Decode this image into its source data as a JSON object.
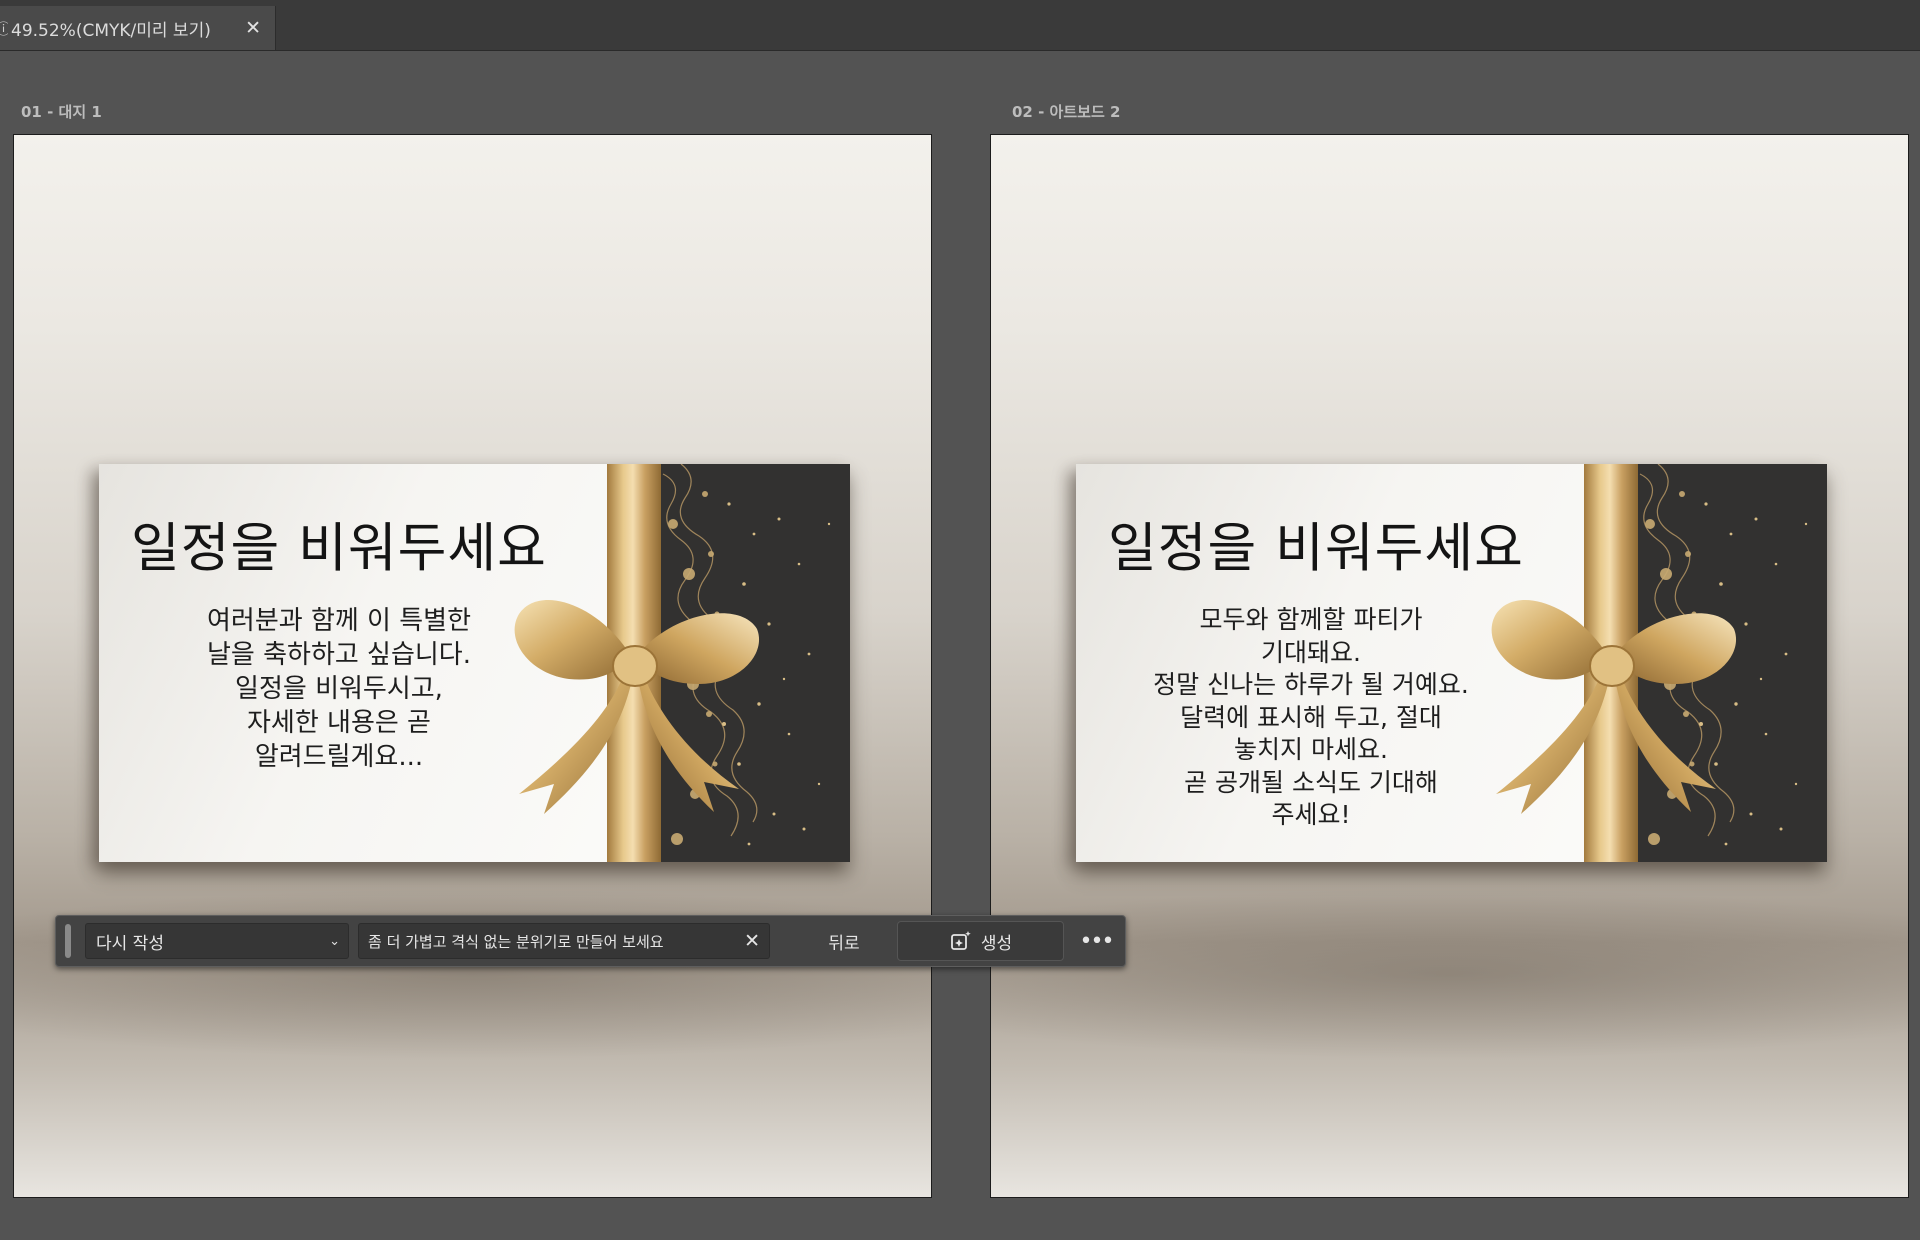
{
  "document_tab": {
    "edge_glyph": "ⓘ",
    "title": "49.52%(CMYK/미리 보기)",
    "close_glyph": "✕"
  },
  "artboards": [
    {
      "label": "01 - 대지 1",
      "card": {
        "title": "일정을 비워두세요",
        "body_lines": [
          "여러분과 함께 이 특별한",
          "날을 축하하고 싶습니다.",
          "일정을 비워두시고,",
          "자세한 내용은 곧",
          "알려드릴게요..."
        ]
      }
    },
    {
      "label": "02 - 아트보드 2",
      "card": {
        "title": "일정을 비워두세요",
        "body_lines": [
          "모두와 함께할 파티가",
          "기대돼요.",
          "정말 신나는 하루가 될 거예요.",
          "달력에 표시해 두고, 절대",
          "놓치지 마세요.",
          "곧 공개될 소식도 기대해",
          "주세요!"
        ]
      }
    }
  ],
  "taskbar": {
    "mode_select_value": "다시 작성",
    "chevron_glyph": "⌄",
    "prompt_value": "좀 더 가볍고 격식 없는 분위기로 만들어 보세요",
    "clear_glyph": "✕",
    "back_label": "뒤로",
    "generate_label": "생성",
    "more_glyph": "•••"
  },
  "icons": {
    "close": "close-icon",
    "chevron": "chevron-down-icon",
    "generate": "generative-sparkle-icon",
    "more": "more-horizontal-icon"
  },
  "colors": {
    "app_background": "#535353",
    "tab_bar": "#3a3a3a",
    "card_dark_panel": "#323130",
    "ribbon_gold": "#e7c98c",
    "taskbar": "#434343"
  }
}
